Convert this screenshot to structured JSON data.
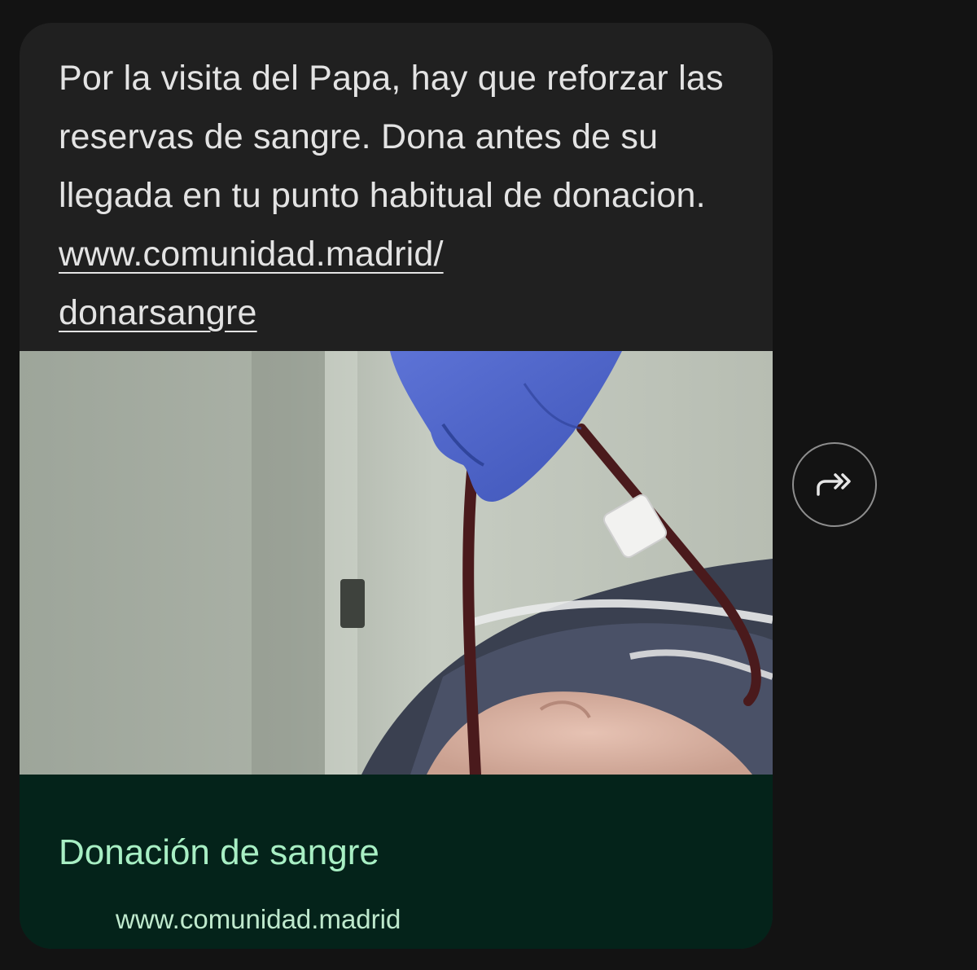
{
  "message": {
    "text_before_link": "Por la visita del Papa, hay que reforzar las reservas de sangre. Dona antes de su llegada en tu punto habitual de donacion. ",
    "link_line_1": "www.comunidad.madrid/",
    "link_line_2": "donarsangre"
  },
  "link_preview": {
    "title": "Donación de sangre",
    "domain": "www.comunidad.madrid"
  },
  "share_button": {
    "icon": "forward-share-icon"
  },
  "colors": {
    "background": "#131313",
    "bubble": "#202020",
    "message_text": "#e3e3e3",
    "preview_footer": "#04231a",
    "preview_title": "#a8efc4",
    "preview_domain": "#bfe9cd"
  }
}
